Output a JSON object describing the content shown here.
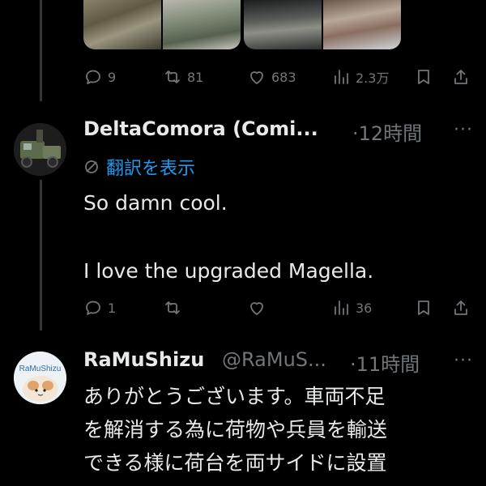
{
  "tweet_top": {
    "replies": "9",
    "retweets": "81",
    "likes": "683",
    "views": "2.3万"
  },
  "reply1": {
    "name": "DeltaComora (Comi...",
    "time": "·12時間",
    "more": "···",
    "translate_label": "翻訳を表示",
    "text_line1": "So damn cool.",
    "text_line2": "I love the upgraded Magella.",
    "replies": "1",
    "retweets": "",
    "likes": "",
    "views": "36"
  },
  "reply2": {
    "name": "RaMuShizu",
    "handle": "@RaMuS...",
    "time": "·11時間",
    "more": "···",
    "avatar_text": "RaMuShizu",
    "text_lines": [
      "ありがとうございます。車両不足",
      "を解消する為に荷物や兵員を輸送",
      "できる様に荷台を両サイドに設置"
    ]
  },
  "colors": {
    "background": "#000000",
    "text": "#e7e9ea",
    "muted": "#71767b",
    "link": "#1d9bf0",
    "thread_line": "#333639"
  },
  "icons": [
    "reply-icon",
    "retweet-icon",
    "like-icon",
    "views-icon",
    "bookmark-icon",
    "share-icon",
    "translate-icon"
  ]
}
